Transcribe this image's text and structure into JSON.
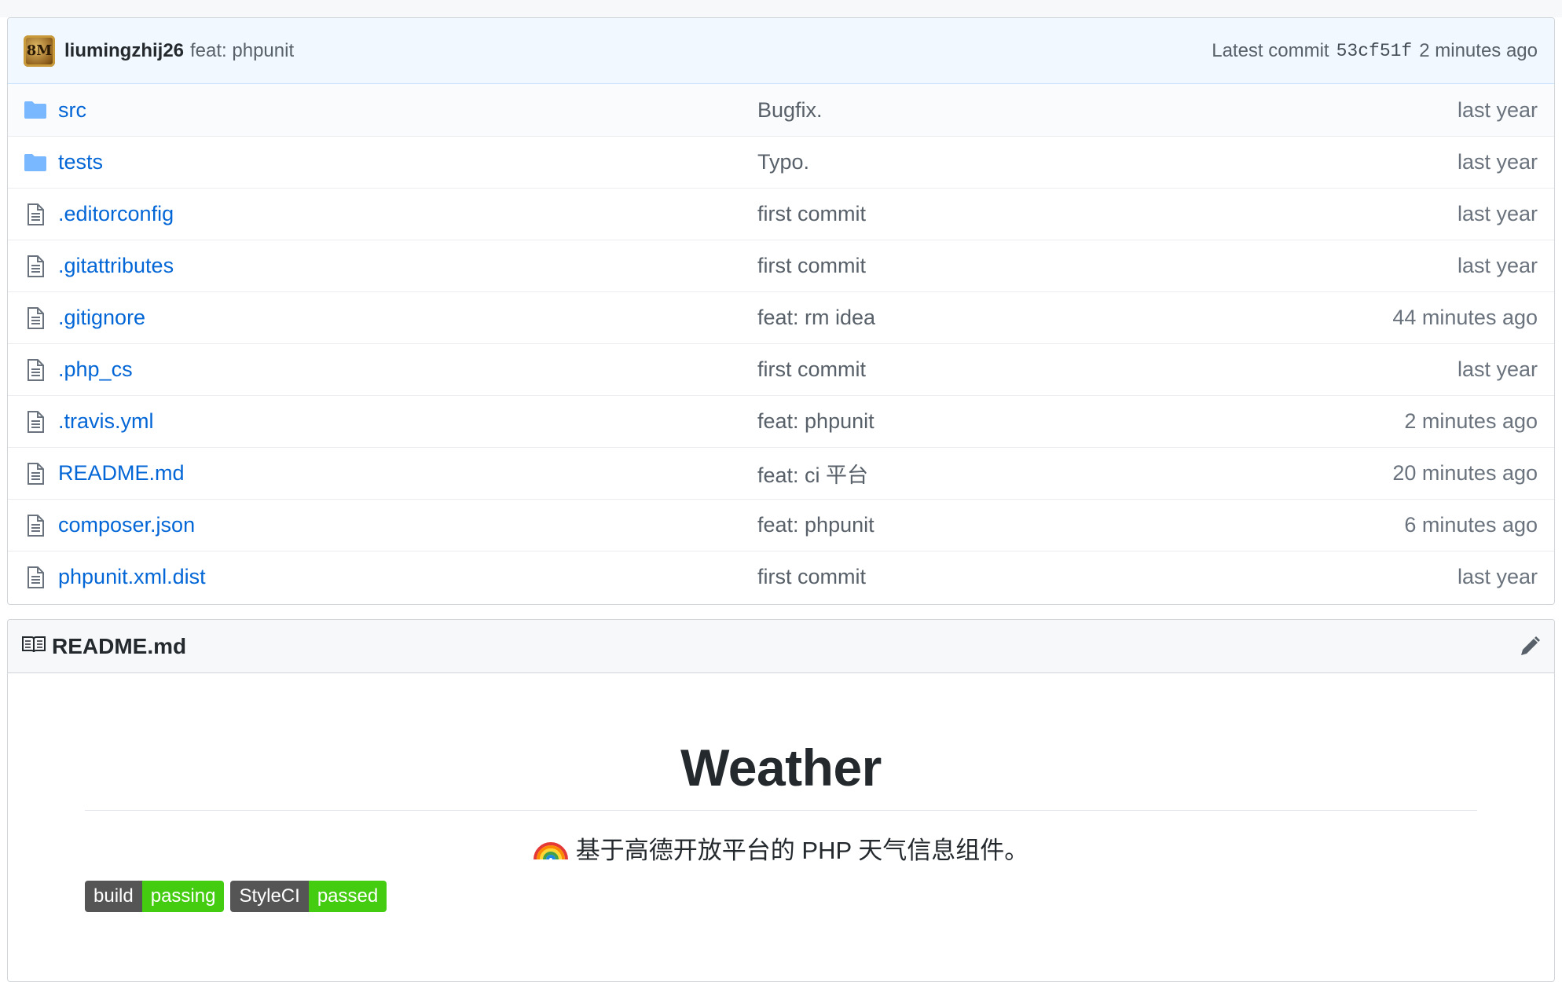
{
  "commit": {
    "author": "liumingzhij26",
    "message": "feat: phpunit",
    "latest_label": "Latest commit",
    "sha": "53cf51f",
    "time": "2 minutes ago",
    "avatar_text": "8M"
  },
  "files": [
    {
      "name": "src",
      "type": "folder",
      "message": "Bugfix.",
      "age": "last year"
    },
    {
      "name": "tests",
      "type": "folder",
      "message": "Typo.",
      "age": "last year"
    },
    {
      "name": ".editorconfig",
      "type": "file",
      "message": "first commit",
      "age": "last year"
    },
    {
      "name": ".gitattributes",
      "type": "file",
      "message": "first commit",
      "age": "last year"
    },
    {
      "name": ".gitignore",
      "type": "file",
      "message": "feat: rm idea",
      "age": "44 minutes ago"
    },
    {
      "name": ".php_cs",
      "type": "file",
      "message": "first commit",
      "age": "last year"
    },
    {
      "name": ".travis.yml",
      "type": "file",
      "message": "feat: phpunit",
      "age": "2 minutes ago"
    },
    {
      "name": "README.md",
      "type": "file",
      "message": "feat: ci 平台",
      "age": "20 minutes ago"
    },
    {
      "name": "composer.json",
      "type": "file",
      "message": "feat: phpunit",
      "age": "6 minutes ago"
    },
    {
      "name": "phpunit.xml.dist",
      "type": "file",
      "message": "first commit",
      "age": "last year"
    }
  ],
  "readme": {
    "filename": "README.md",
    "title": "Weather",
    "description": "基于高德开放平台的 PHP 天气信息组件。",
    "badges": [
      {
        "label": "build",
        "status": "passing"
      },
      {
        "label": "StyleCI",
        "status": "passed"
      }
    ]
  },
  "icons": {
    "folder": "folder-icon",
    "file": "file-icon",
    "book": "book-icon",
    "edit": "pencil-icon",
    "rainbow": "rainbow-icon"
  },
  "colors": {
    "link": "#0366d6",
    "folder": "#79b8ff",
    "commit_bar_bg": "#f1f8ff",
    "badge_green": "#44cc11",
    "badge_gray": "#555555"
  }
}
